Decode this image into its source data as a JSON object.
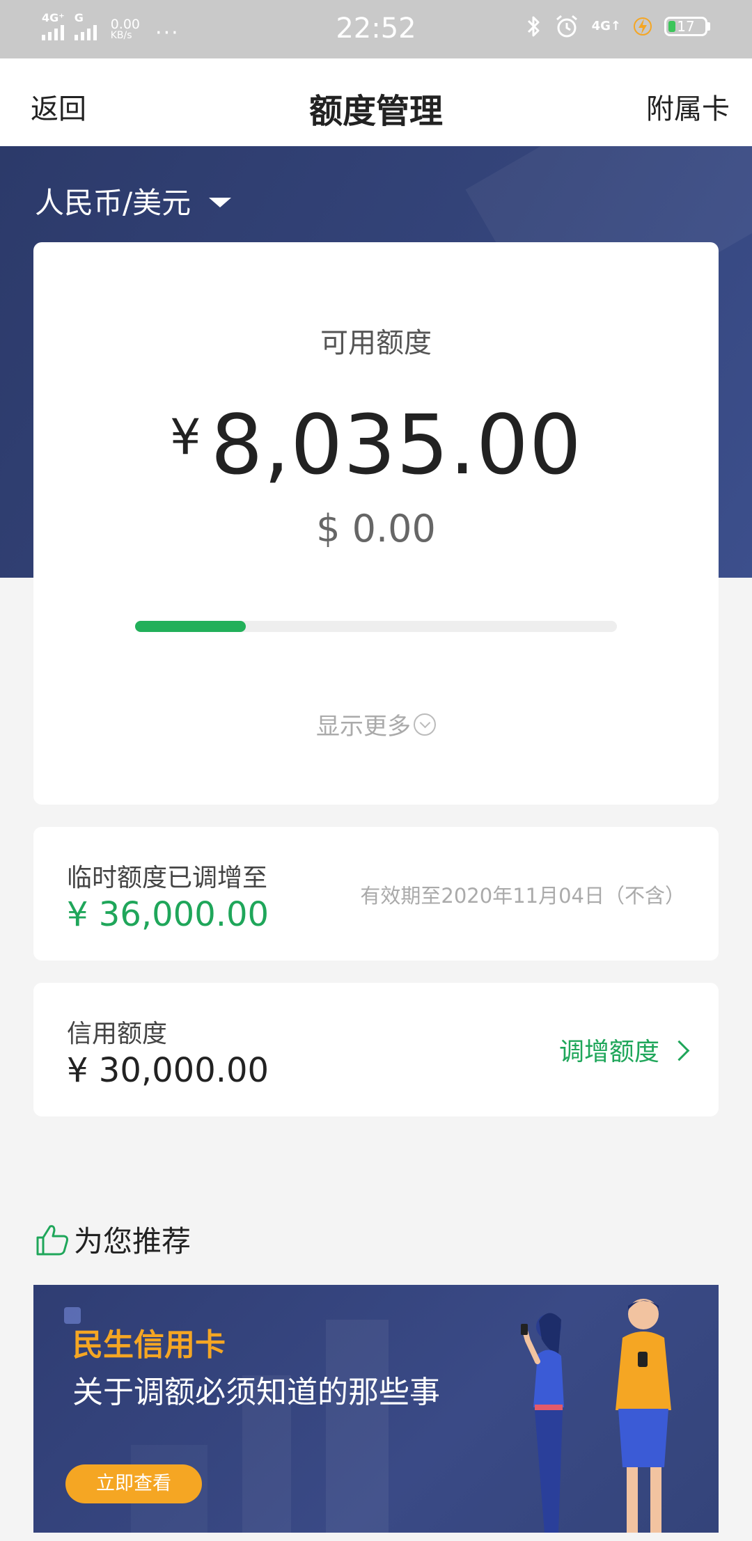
{
  "status_bar": {
    "signal1": "4G⁺",
    "signal2": "G",
    "speed_value": "0.00",
    "speed_unit": "KB/s",
    "more": "···",
    "time": "22:52",
    "network": "4G↑",
    "battery": "17"
  },
  "nav": {
    "back": "返回",
    "title": "额度管理",
    "right": "附属卡"
  },
  "currency_selector": "人民币/美元",
  "available": {
    "label": "可用额度",
    "cny_symbol": "¥",
    "cny_amount": "8,035.00",
    "usd": "$ 0.00",
    "progress_fraction": 0.23,
    "show_more": "显示更多"
  },
  "temp_limit": {
    "label": "临时额度已调增至",
    "amount": "¥ 36,000.00",
    "note": "有效期至2020年11月04日（不含）"
  },
  "credit_limit": {
    "label": "信用额度",
    "amount": "¥ 30,000.00",
    "action": "调增额度"
  },
  "recommend": {
    "heading": "为您推荐"
  },
  "banner": {
    "brand": "民生信用卡",
    "title": "关于调额必须知道的那些事",
    "button": "立即查看"
  },
  "colors": {
    "accent_green": "#1fa65a",
    "header_blue": "#34447a",
    "banner_orange": "#f5a623"
  }
}
